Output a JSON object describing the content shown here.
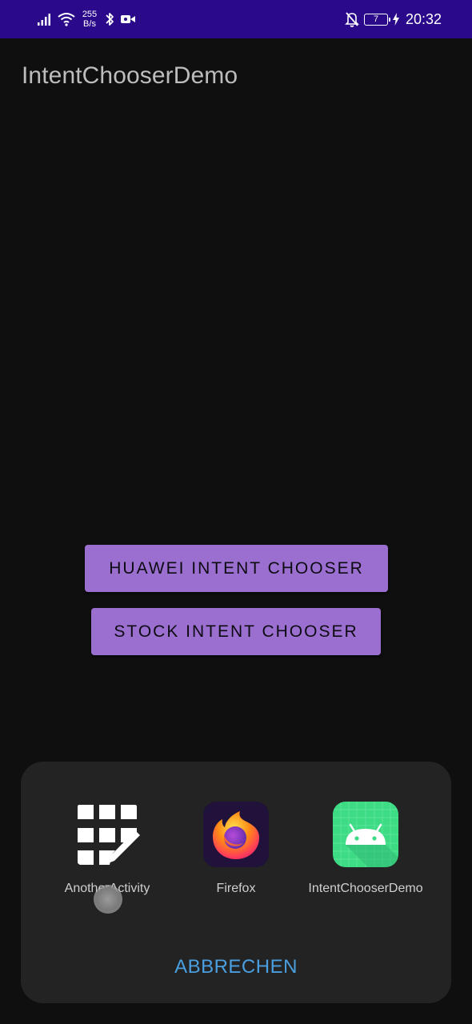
{
  "status_bar": {
    "net_speed_value": "255",
    "net_speed_unit": "B/s",
    "battery_level": "7",
    "time": "20:32",
    "icons": [
      "signal-icon",
      "wifi-icon",
      "bluetooth-icon",
      "video-recording-icon",
      "mute-bell-icon",
      "battery-icon",
      "charging-icon"
    ]
  },
  "app_bar": {
    "title": "IntentChooserDemo"
  },
  "main": {
    "huawei_button_label": "HUAWEI INTENT CHOOSER",
    "stock_button_label": "STOCK INTENT CHOOSER"
  },
  "chooser": {
    "apps": [
      {
        "label": "AnotherActivity",
        "icon": "another-activity-icon"
      },
      {
        "label": "Firefox",
        "icon": "firefox-icon"
      },
      {
        "label": "IntentChooserDemo",
        "icon": "android-icon"
      }
    ],
    "cancel_label": "ABBRECHEN"
  },
  "colors": {
    "status_bar": "#2a0a8a",
    "background": "#0f0f0f",
    "button": "#9b6fd0",
    "sheet": "#232323",
    "cancel_text": "#4a9fe0",
    "android_icon_bg": "#3ddc84"
  }
}
